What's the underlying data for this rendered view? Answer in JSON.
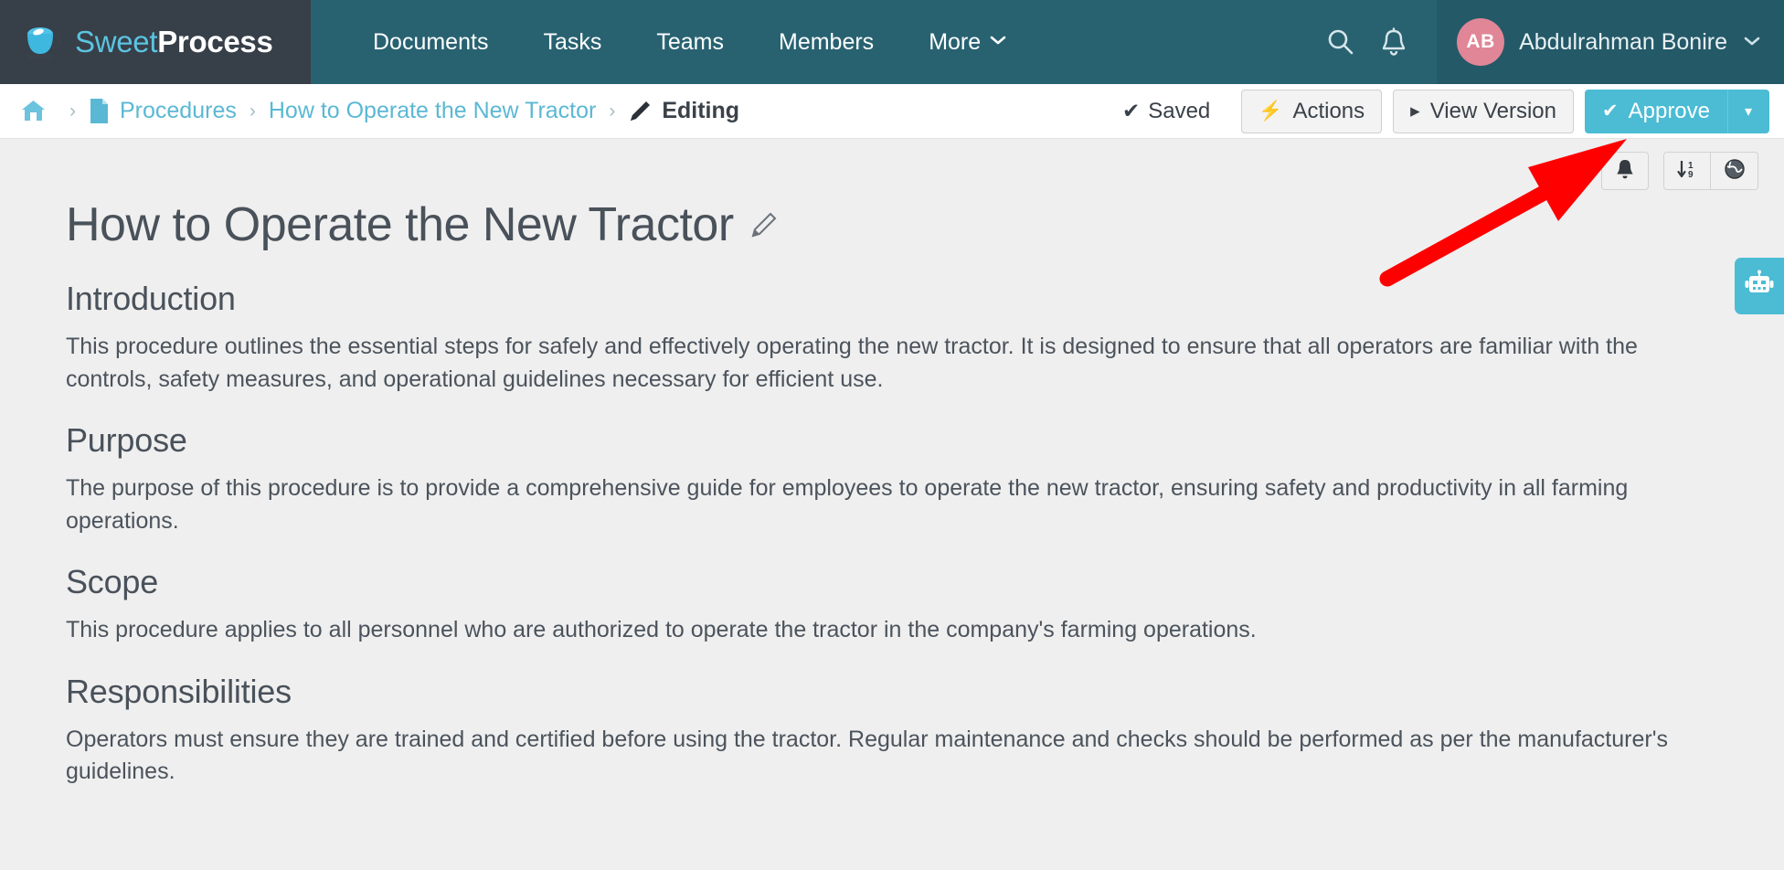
{
  "brand": {
    "name_light": "Sweet",
    "name_bold": "Process",
    "logo_icon": "coffee-cup-icon"
  },
  "topnav": {
    "links": [
      {
        "label": "Documents",
        "icon": ""
      },
      {
        "label": "Tasks",
        "icon": ""
      },
      {
        "label": "Teams",
        "icon": ""
      },
      {
        "label": "Members",
        "icon": ""
      },
      {
        "label": "More",
        "icon": "chevron-down-icon",
        "caret": "⌄"
      }
    ],
    "search_icon": "search-icon",
    "bell_icon": "bell-icon",
    "user": {
      "initials": "AB",
      "name": "Abdulrahman Bonire",
      "caret": "⌄"
    }
  },
  "breadcrumb": {
    "home_icon": "home-icon",
    "separator": "›",
    "items": [
      {
        "label": "Procedures",
        "icon": "document-icon"
      },
      {
        "label": "How to Operate the New Tractor",
        "icon": ""
      },
      {
        "label": "Editing",
        "icon": "pencil-icon"
      }
    ]
  },
  "toolbar": {
    "saved_label": "Saved",
    "saved_tick": "✔",
    "actions_label": "Actions",
    "actions_icon": "⚡",
    "view_version_label": "View Version",
    "view_version_icon": "▸",
    "approve_label": "Approve",
    "approve_icon": "✔",
    "approve_caret": "▾",
    "approve_color": "#4bbcd4"
  },
  "subtoolbar": {
    "buttons": [
      {
        "icon": "bell-icon"
      },
      {
        "icon": "sort-numeric-icon"
      },
      {
        "icon": "globe-icon"
      }
    ]
  },
  "document": {
    "title": "How to Operate the New Tractor",
    "title_edit_icon": "pencil-icon",
    "sections": [
      {
        "heading": "Introduction",
        "body": "This procedure outlines the essential steps for safely and effectively operating the new tractor. It is designed to ensure that all operators are familiar with the controls, safety measures, and operational guidelines necessary for efficient use."
      },
      {
        "heading": "Purpose",
        "body": "The purpose of this procedure is to provide a comprehensive guide for employees to operate the new tractor, ensuring safety and productivity in all farming operations."
      },
      {
        "heading": "Scope",
        "body": "This procedure applies to all personnel who are authorized to operate the tractor in the company's farming operations."
      },
      {
        "heading": "Responsibilities",
        "body": "Operators must ensure they are trained and certified before using the tractor. Regular maintenance and checks should be performed as per the manufacturer's guidelines."
      }
    ]
  },
  "chat_widget": {
    "icon": "robot-icon",
    "color": "#4bbcd4"
  },
  "annotation": {
    "arrow_color": "#ff0000",
    "points_to": "approve-button"
  }
}
